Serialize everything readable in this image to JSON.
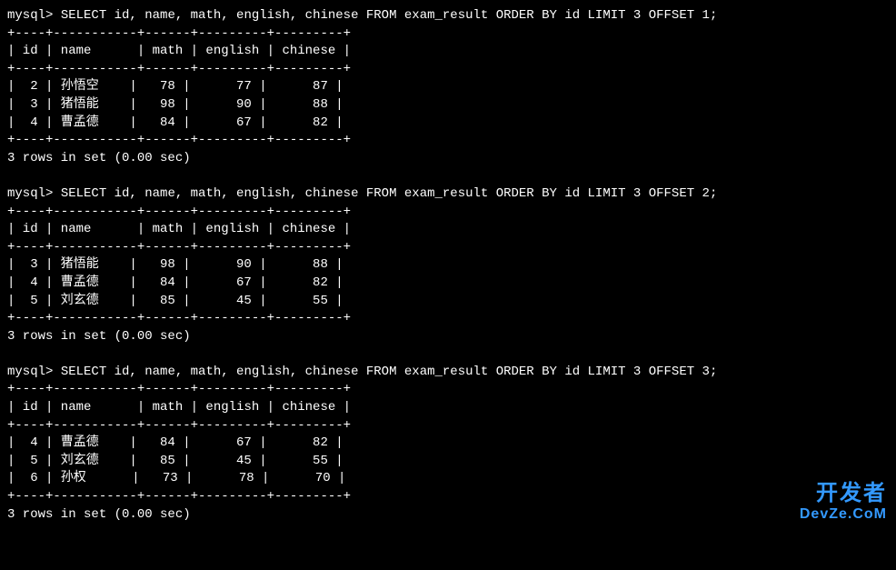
{
  "prompt": "mysql>",
  "queries": [
    {
      "sql": " SELECT id, name, math, english, chinese FROM exam_result ORDER BY id LIMIT 3 OFFSET 1;",
      "border": "+----+-----------+------+---------+---------+",
      "header": "| id | name      | math | english | chinese |",
      "rows": [
        "|  2 | 孙悟空    |   78 |      77 |      87 |",
        "|  3 | 猪悟能    |   98 |      90 |      88 |",
        "|  4 | 曹孟德    |   84 |      67 |      82 |"
      ],
      "status": "3 rows in set (0.00 sec)"
    },
    {
      "sql": " SELECT id, name, math, english, chinese FROM exam_result ORDER BY id LIMIT 3 OFFSET 2;",
      "border": "+----+-----------+------+---------+---------+",
      "header": "| id | name      | math | english | chinese |",
      "rows": [
        "|  3 | 猪悟能    |   98 |      90 |      88 |",
        "|  4 | 曹孟德    |   84 |      67 |      82 |",
        "|  5 | 刘玄德    |   85 |      45 |      55 |"
      ],
      "status": "3 rows in set (0.00 sec)"
    },
    {
      "sql": " SELECT id, name, math, english, chinese FROM exam_result ORDER BY id LIMIT 3 OFFSET 3;",
      "border": "+----+-----------+------+---------+---------+",
      "header": "| id | name      | math | english | chinese |",
      "rows": [
        "|  4 | 曹孟德    |   84 |      67 |      82 |",
        "|  5 | 刘玄德    |   85 |      45 |      55 |",
        "|  6 | 孙权      |   73 |      78 |      70 |"
      ],
      "status": "3 rows in set (0.00 sec)"
    }
  ],
  "watermark": {
    "line1": "开发者",
    "line2": "DevZe.CoM"
  }
}
